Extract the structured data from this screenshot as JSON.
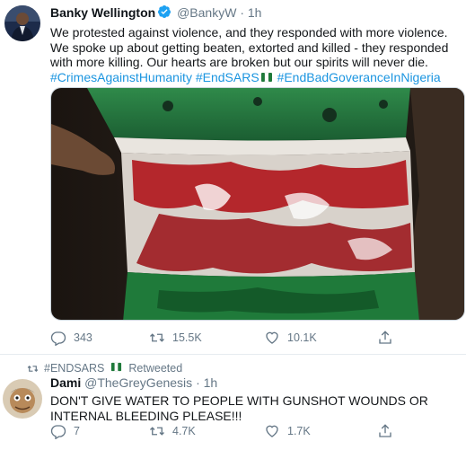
{
  "tweet1": {
    "display_name": "Banky Wellington",
    "handle": "@BankyW",
    "separator": "·",
    "time": "1h",
    "text_plain": "We protested against violence, and they responded with more violence. We spoke up about getting beaten, extorted and killed - they responded with more killing. Our hearts are broken but our spirits will never die.",
    "hashtag1": "#CrimesAgainstHumanity",
    "hashtag2": "#EndSARS",
    "hashtag3": "#EndBadGoveranceInNigeria",
    "replies": "343",
    "retweets": "15.5K",
    "likes": "10.1K"
  },
  "tweet2": {
    "retweet_source": "#ENDSARS",
    "retweet_label": "Retweeted",
    "display_name": "Dami",
    "handle": "@TheGreyGenesis",
    "separator": "·",
    "time": "1h",
    "text": "DON'T GIVE WATER TO PEOPLE WITH GUNSHOT WOUNDS OR INTERNAL BLEEDING PLEASE!!!",
    "replies": "7",
    "retweets": "4.7K",
    "likes": "1.7K"
  },
  "colors": {
    "link": "#1b95e0",
    "secondary": "#657786",
    "verified": "#1da1f2",
    "flag_green": "#1f7a3a"
  },
  "icons": [
    "verified-badge-icon",
    "flag-emoji-icon",
    "reply-icon",
    "retweet-icon",
    "like-icon",
    "share-icon",
    "retweeted-icon"
  ]
}
